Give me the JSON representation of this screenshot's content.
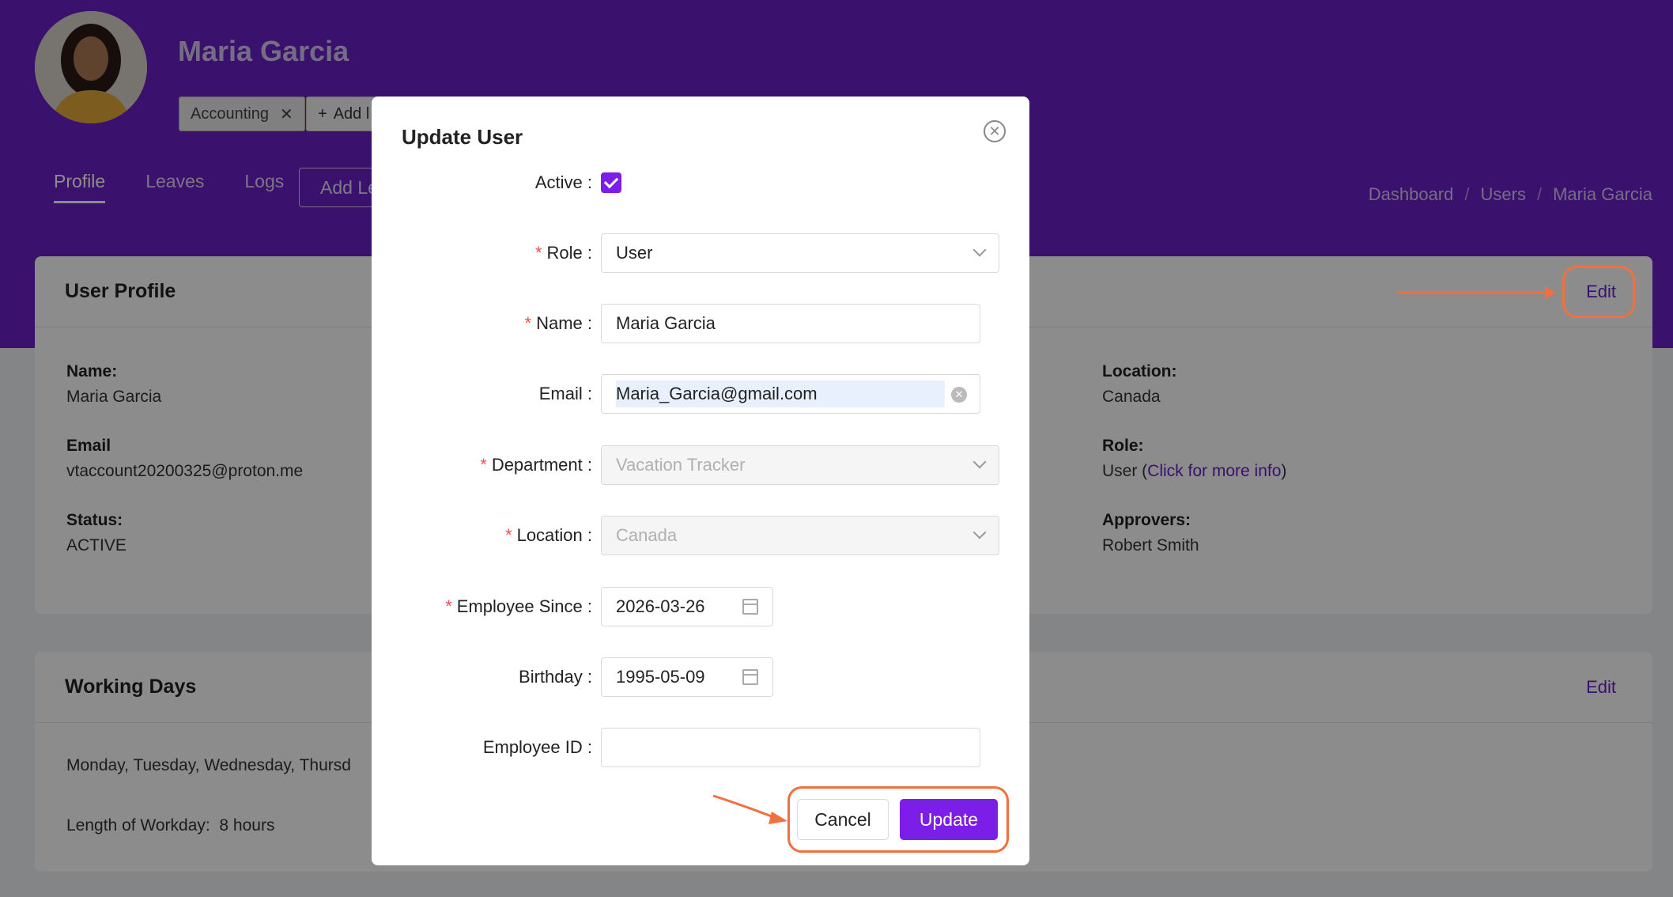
{
  "header": {
    "user_name": "Maria Garcia",
    "tag_label": "Accounting",
    "add_label": "Add l",
    "tabs": [
      {
        "label": "Profile",
        "active": true
      },
      {
        "label": "Leaves"
      },
      {
        "label": "Logs"
      }
    ],
    "add_leave_label": "Add Le",
    "breadcrumb": [
      "Dashboard",
      "Users",
      "Maria Garcia"
    ],
    "accent_color": "#6a1fc7"
  },
  "profile_card": {
    "title": "User Profile",
    "edit_label": "Edit",
    "name_label": "Name:",
    "name_value": "Maria Garcia",
    "email_label": "Email",
    "email_value": "vtaccount20200325@proton.me",
    "status_label": "Status:",
    "status_value": "ACTIVE",
    "location_label": "Location:",
    "location_value": "Canada",
    "role_label": "Role:",
    "role_value": "User",
    "role_link": "Click for more info",
    "approvers_label": "Approvers:",
    "approvers_value": "Robert Smith"
  },
  "working_days_card": {
    "title": "Working Days",
    "edit_label": "Edit",
    "days": "Monday, Tuesday, Wednesday, Thursd",
    "workday_label": "Length of Workday:",
    "workday_value": "8 hours"
  },
  "modal": {
    "title": "Update User",
    "fields": {
      "active": {
        "label": "Active",
        "checked": true
      },
      "role": {
        "label": "Role",
        "required": true,
        "value": "User"
      },
      "name": {
        "label": "Name",
        "required": true,
        "value": "Maria Garcia"
      },
      "email": {
        "label": "Email",
        "value": "Maria_Garcia@gmail.com"
      },
      "department": {
        "label": "Department",
        "required": true,
        "value": "Vacation Tracker"
      },
      "location": {
        "label": "Location",
        "required": true,
        "value": "Canada"
      },
      "employee_since": {
        "label": "Employee Since",
        "required": true,
        "value": "2026-03-26"
      },
      "birthday": {
        "label": "Birthday",
        "value": "1995-05-09"
      },
      "employee_id": {
        "label": "Employee ID",
        "value": ""
      }
    },
    "cancel_label": "Cancel",
    "update_label": "Update",
    "button_color": "#7c1de8"
  },
  "annotation_color": "#f07040",
  "icons": [
    "close-icon",
    "plus-icon",
    "chevron-down-icon",
    "clear-icon",
    "calendar-icon",
    "check-icon"
  ]
}
